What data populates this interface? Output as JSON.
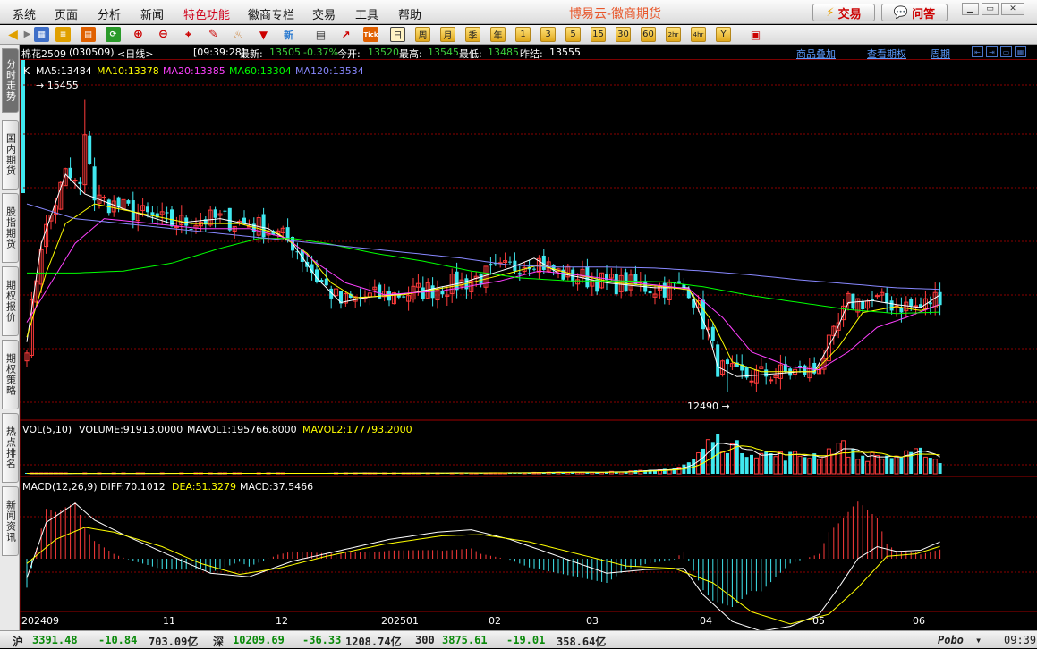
{
  "menu": [
    "系统",
    "页面",
    "分析",
    "新闻",
    "特色功能",
    "徽商专栏",
    "交易",
    "工具",
    "帮助"
  ],
  "app_title": "博易云-徽商期货",
  "buttons": {
    "trade": "交易",
    "ask": "问答"
  },
  "toolbar_periods": [
    "日",
    "周",
    "月",
    "季",
    "年",
    "1",
    "3",
    "5",
    "15",
    "30",
    "60",
    "2hr",
    "4hr",
    "Y"
  ],
  "sidebar_tabs": [
    "分时走势",
    "国内期货",
    "股指期货",
    "期权报价",
    "期权策略",
    "热点排名",
    "新闻资讯"
  ],
  "info": {
    "symbol": "棉花2509",
    "code": "(030509)",
    "period": "<日线>",
    "time": "[09:39:28]",
    "latest_label": "最新:",
    "latest": "13505",
    "change": "-0.37%",
    "open_label": "今开:",
    "open": "13520",
    "high_label": "最高:",
    "high": "13545",
    "low_label": "最低:",
    "low": "13485",
    "prev_label": "昨结:",
    "prev": "13555",
    "links": [
      "商品叠加",
      "查看期权",
      "周期"
    ]
  },
  "ma_legend": {
    "k": "K",
    "ma5": "MA5:13484",
    "ma10": "MA10:13378",
    "ma20": "MA20:13385",
    "ma60": "MA60:13304",
    "ma120": "MA120:13534"
  },
  "vol_legend": {
    "name": "VOL(5,10)",
    "volume": "VOLUME:91913.0000",
    "mavol1": "MAVOL1:195766.8000",
    "mavol2": "MAVOL2:177793.2000"
  },
  "macd_legend": {
    "name": "MACD(12,26,9)",
    "diff": "DIFF:70.1012",
    "dea": "DEA:51.3279",
    "macd": "MACD:37.5466"
  },
  "colors": {
    "up": "#ff3b3b",
    "down": "#40e8f0",
    "ma5": "#ffffff",
    "ma10": "#ffff00",
    "ma20": "#ff40ff",
    "ma60": "#00ff00",
    "ma120": "#8888ff",
    "grid": "#8b0000"
  },
  "chart_data": {
    "type": "candlestick",
    "price_range": [
      12490,
      15455
    ],
    "max_label": "15455",
    "min_label": "12490",
    "x_labels": [
      "202409",
      "11",
      "12",
      "202501",
      "02",
      "03",
      "04",
      "05",
      "06"
    ],
    "ma_anchors": {
      "ma5": [
        [
          0,
          13000
        ],
        [
          3,
          14000
        ],
        [
          8,
          14700
        ],
        [
          12,
          14500
        ],
        [
          20,
          14350
        ],
        [
          30,
          14200
        ],
        [
          40,
          14250
        ],
        [
          50,
          14150
        ],
        [
          55,
          14000
        ],
        [
          60,
          13650
        ],
        [
          65,
          13400
        ],
        [
          70,
          13450
        ],
        [
          80,
          13500
        ],
        [
          90,
          13600
        ],
        [
          100,
          13750
        ],
        [
          105,
          13850
        ],
        [
          110,
          13700
        ],
        [
          120,
          13600
        ],
        [
          130,
          13550
        ],
        [
          137,
          13550
        ],
        [
          141,
          13100
        ],
        [
          143,
          12750
        ],
        [
          147,
          12650
        ],
        [
          155,
          12680
        ],
        [
          160,
          12700
        ],
        [
          163,
          12700
        ],
        [
          167,
          13050
        ],
        [
          170,
          13400
        ],
        [
          175,
          13420
        ],
        [
          180,
          13380
        ],
        [
          185,
          13350
        ],
        [
          189,
          13480
        ]
      ],
      "ma10": [
        [
          0,
          13050
        ],
        [
          4,
          13700
        ],
        [
          8,
          14200
        ],
        [
          14,
          14400
        ],
        [
          24,
          14300
        ],
        [
          34,
          14200
        ],
        [
          44,
          14200
        ],
        [
          52,
          14100
        ],
        [
          58,
          13900
        ],
        [
          63,
          13600
        ],
        [
          68,
          13450
        ],
        [
          78,
          13480
        ],
        [
          90,
          13580
        ],
        [
          100,
          13700
        ],
        [
          106,
          13780
        ],
        [
          112,
          13700
        ],
        [
          122,
          13600
        ],
        [
          132,
          13560
        ],
        [
          137,
          13530
        ],
        [
          142,
          13200
        ],
        [
          146,
          12800
        ],
        [
          152,
          12700
        ],
        [
          158,
          12700
        ],
        [
          163,
          12700
        ],
        [
          168,
          12950
        ],
        [
          173,
          13300
        ],
        [
          180,
          13360
        ],
        [
          185,
          13320
        ],
        [
          189,
          13378
        ]
      ],
      "ma20": [
        [
          0,
          13200
        ],
        [
          5,
          13600
        ],
        [
          10,
          14000
        ],
        [
          16,
          14250
        ],
        [
          26,
          14200
        ],
        [
          36,
          14150
        ],
        [
          46,
          14150
        ],
        [
          54,
          14050
        ],
        [
          60,
          13800
        ],
        [
          66,
          13600
        ],
        [
          74,
          13480
        ],
        [
          86,
          13520
        ],
        [
          98,
          13620
        ],
        [
          106,
          13720
        ],
        [
          114,
          13680
        ],
        [
          126,
          13600
        ],
        [
          137,
          13540
        ],
        [
          144,
          13250
        ],
        [
          150,
          12900
        ],
        [
          158,
          12750
        ],
        [
          164,
          12720
        ],
        [
          170,
          12900
        ],
        [
          176,
          13150
        ],
        [
          182,
          13250
        ],
        [
          189,
          13385
        ]
      ],
      "ma60": [
        [
          0,
          13700
        ],
        [
          10,
          13700
        ],
        [
          20,
          13720
        ],
        [
          30,
          13800
        ],
        [
          40,
          13950
        ],
        [
          48,
          14050
        ],
        [
          55,
          14050
        ],
        [
          62,
          14000
        ],
        [
          72,
          13900
        ],
        [
          82,
          13820
        ],
        [
          92,
          13720
        ],
        [
          102,
          13650
        ],
        [
          112,
          13620
        ],
        [
          122,
          13620
        ],
        [
          132,
          13610
        ],
        [
          140,
          13560
        ],
        [
          150,
          13470
        ],
        [
          160,
          13400
        ],
        [
          170,
          13330
        ],
        [
          180,
          13290
        ],
        [
          189,
          13304
        ]
      ],
      "ma120": [
        [
          0,
          14400
        ],
        [
          10,
          14250
        ],
        [
          20,
          14200
        ],
        [
          30,
          14150
        ],
        [
          40,
          14100
        ],
        [
          50,
          14050
        ],
        [
          60,
          14000
        ],
        [
          70,
          13950
        ],
        [
          80,
          13900
        ],
        [
          90,
          13850
        ],
        [
          100,
          13780
        ],
        [
          110,
          13760
        ],
        [
          120,
          13760
        ],
        [
          130,
          13750
        ],
        [
          140,
          13720
        ],
        [
          150,
          13680
        ],
        [
          160,
          13630
        ],
        [
          170,
          13590
        ],
        [
          180,
          13550
        ],
        [
          189,
          13534
        ]
      ]
    },
    "volume_anchors": [
      [
        0,
        3000
      ],
      [
        40,
        4000
      ],
      [
        80,
        5000
      ],
      [
        110,
        12000
      ],
      [
        120,
        18000
      ],
      [
        130,
        28000
      ],
      [
        135,
        60000
      ],
      [
        138,
        120000
      ],
      [
        140,
        220000
      ],
      [
        142,
        310000
      ],
      [
        145,
        250000
      ],
      [
        150,
        200000
      ],
      [
        155,
        160000
      ],
      [
        160,
        160000
      ],
      [
        165,
        170000
      ],
      [
        168,
        260000
      ],
      [
        172,
        150000
      ],
      [
        178,
        150000
      ],
      [
        183,
        160000
      ],
      [
        186,
        200000
      ],
      [
        189,
        91913
      ]
    ],
    "macd_diff_anchors": [
      [
        0,
        -80
      ],
      [
        4,
        150
      ],
      [
        10,
        230
      ],
      [
        14,
        160
      ],
      [
        20,
        100
      ],
      [
        30,
        10
      ],
      [
        38,
        -60
      ],
      [
        46,
        -75
      ],
      [
        55,
        -10
      ],
      [
        64,
        30
      ],
      [
        75,
        80
      ],
      [
        85,
        110
      ],
      [
        92,
        120
      ],
      [
        100,
        80
      ],
      [
        110,
        10
      ],
      [
        120,
        -60
      ],
      [
        128,
        -45
      ],
      [
        136,
        -40
      ],
      [
        140,
        -150
      ],
      [
        146,
        -260
      ],
      [
        152,
        -300
      ],
      [
        158,
        -280
      ],
      [
        164,
        -230
      ],
      [
        168,
        -120
      ],
      [
        172,
        0
      ],
      [
        176,
        50
      ],
      [
        180,
        30
      ],
      [
        185,
        35
      ],
      [
        189,
        70
      ]
    ],
    "macd_dea_anchors": [
      [
        0,
        -20
      ],
      [
        6,
        80
      ],
      [
        12,
        130
      ],
      [
        18,
        110
      ],
      [
        28,
        50
      ],
      [
        36,
        -20
      ],
      [
        44,
        -65
      ],
      [
        52,
        -40
      ],
      [
        62,
        10
      ],
      [
        74,
        60
      ],
      [
        86,
        95
      ],
      [
        94,
        100
      ],
      [
        104,
        70
      ],
      [
        114,
        20
      ],
      [
        124,
        -30
      ],
      [
        134,
        -40
      ],
      [
        142,
        -100
      ],
      [
        150,
        -220
      ],
      [
        158,
        -270
      ],
      [
        166,
        -230
      ],
      [
        172,
        -120
      ],
      [
        178,
        10
      ],
      [
        184,
        20
      ],
      [
        189,
        51
      ]
    ]
  }
}
